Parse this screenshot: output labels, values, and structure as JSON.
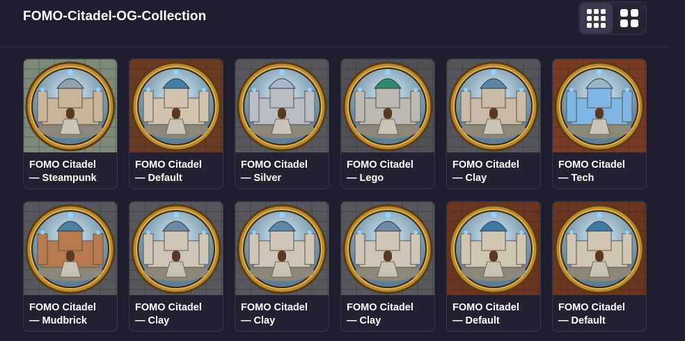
{
  "header": {
    "title": "FOMO-Citadel-OG-Collection",
    "view_options": [
      {
        "name": "small-grid",
        "icon": "grid-3x3-icon",
        "active": true
      },
      {
        "name": "large-grid",
        "icon": "grid-2x2-icon",
        "active": false
      }
    ]
  },
  "cards": [
    {
      "line1": "FOMO Citadel",
      "line2": "— Steampunk",
      "bg": "#7d8a78",
      "castle": "#c9b59a",
      "dome": "#8fa3b0"
    },
    {
      "line1": "FOMO Citadel",
      "line2": "— Default",
      "bg": "#6b3a22",
      "castle": "#d0c4b0",
      "dome": "#3f7fa8"
    },
    {
      "line1": "FOMO Citadel",
      "line2": "— Silver",
      "bg": "#55575c",
      "castle": "#b9bec6",
      "dome": "#a9b7c7"
    },
    {
      "line1": "FOMO Citadel",
      "line2": "— Lego",
      "bg": "#4f5157",
      "castle": "#bdbab3",
      "dome": "#2e8a6e"
    },
    {
      "line1": "FOMO Citadel",
      "line2": "— Clay",
      "bg": "#54555b",
      "castle": "#c8bba8",
      "dome": "#5d86a6"
    },
    {
      "line1": "FOMO Citadel",
      "line2": "— Tech",
      "bg": "#7a3b24",
      "castle": "#7fb6e6",
      "dome": "#9fb4c8"
    },
    {
      "line1": "FOMO Citadel",
      "line2": "— Mudbrick",
      "bg": "#55575c",
      "castle": "#b77a4e",
      "dome": "#4f7fa3"
    },
    {
      "line1": "FOMO Citadel",
      "line2": "— Clay",
      "bg": "#55575c",
      "castle": "#cfc6b8",
      "dome": "#6a8aa5"
    },
    {
      "line1": "FOMO Citadel",
      "line2": "— Clay",
      "bg": "#55575c",
      "castle": "#cfc6b8",
      "dome": "#5f86a4"
    },
    {
      "line1": "FOMO Citadel",
      "line2": "— Clay",
      "bg": "#55575c",
      "castle": "#cfc6b8",
      "dome": "#6a8aa5"
    },
    {
      "line1": "FOMO Citadel",
      "line2": "— Default",
      "bg": "#6b3520",
      "castle": "#d1c6b3",
      "dome": "#3d7aa3"
    },
    {
      "line1": "FOMO Citadel",
      "line2": "— Default",
      "bg": "#6b3520",
      "castle": "#d1c6b3",
      "dome": "#3d7aa3"
    }
  ]
}
